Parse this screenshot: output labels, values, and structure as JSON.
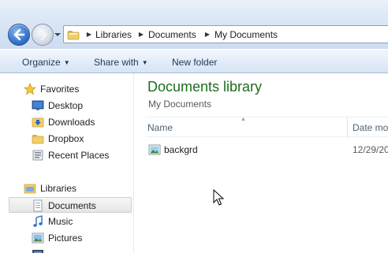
{
  "address_bar": {
    "breadcrumbs": [
      "Libraries",
      "Documents",
      "My Documents"
    ]
  },
  "command_bar": {
    "organize_label": "Organize",
    "share_with_label": "Share with",
    "new_folder_label": "New folder"
  },
  "nav_pane": {
    "favorites_label": "Favorites",
    "favorites": [
      {
        "label": "Desktop",
        "icon": "desktop-icon"
      },
      {
        "label": "Downloads",
        "icon": "downloads-folder-icon"
      },
      {
        "label": "Dropbox",
        "icon": "folder-icon"
      },
      {
        "label": "Recent Places",
        "icon": "recent-places-icon"
      }
    ],
    "libraries_label": "Libraries",
    "libraries": [
      {
        "label": "Documents",
        "icon": "documents-icon",
        "selected": true
      },
      {
        "label": "Music",
        "icon": "music-icon"
      },
      {
        "label": "Pictures",
        "icon": "pictures-icon"
      }
    ]
  },
  "content": {
    "title": "Documents library",
    "subtitle": "My Documents",
    "columns": [
      "Name",
      "Date mo"
    ],
    "files": [
      {
        "name": "backgrd",
        "date": "12/29/20",
        "icon": "image-file-icon"
      }
    ]
  },
  "colors": {
    "title_green": "#1d6e1d",
    "command_text": "#1e395b",
    "header_text": "#4c607a"
  }
}
